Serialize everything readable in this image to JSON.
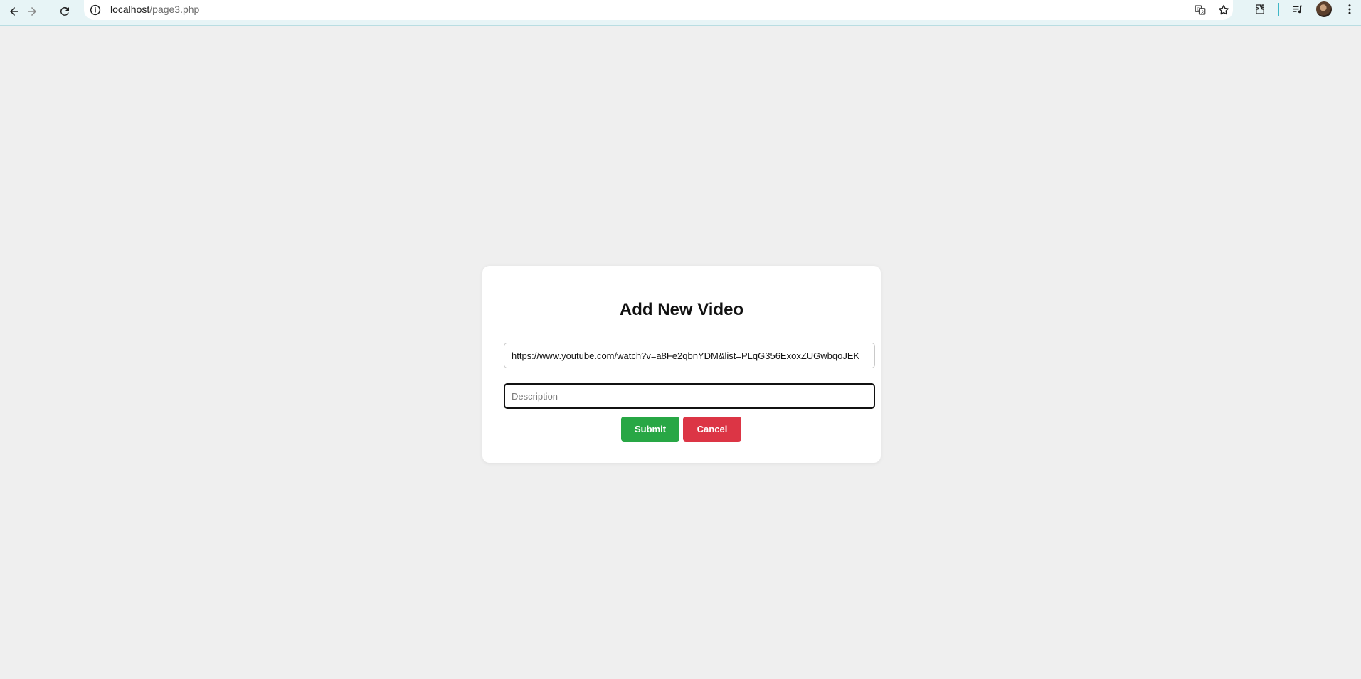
{
  "browser": {
    "url_host": "localhost",
    "url_path": "/page3.php",
    "icons": [
      "back-icon",
      "forward-icon",
      "reload-icon",
      "site-info-icon",
      "translate-icon",
      "bookmark-star-icon",
      "extensions-icon",
      "reading-list-icon",
      "profile-avatar",
      "menu-icon"
    ]
  },
  "form": {
    "title": "Add New Video",
    "url_value": "https://www.youtube.com/watch?v=a8Fe2qbnYDM&list=PLqG356ExoxZUGwbqoJEK",
    "description_placeholder": "Description",
    "description_value": "",
    "submit_label": "Submit",
    "cancel_label": "Cancel"
  },
  "colors": {
    "page_bg": "#efefef",
    "card_bg": "#ffffff",
    "submit": "#28a745",
    "cancel": "#dc3545",
    "toolbar_bg": "#e7f4f6"
  }
}
